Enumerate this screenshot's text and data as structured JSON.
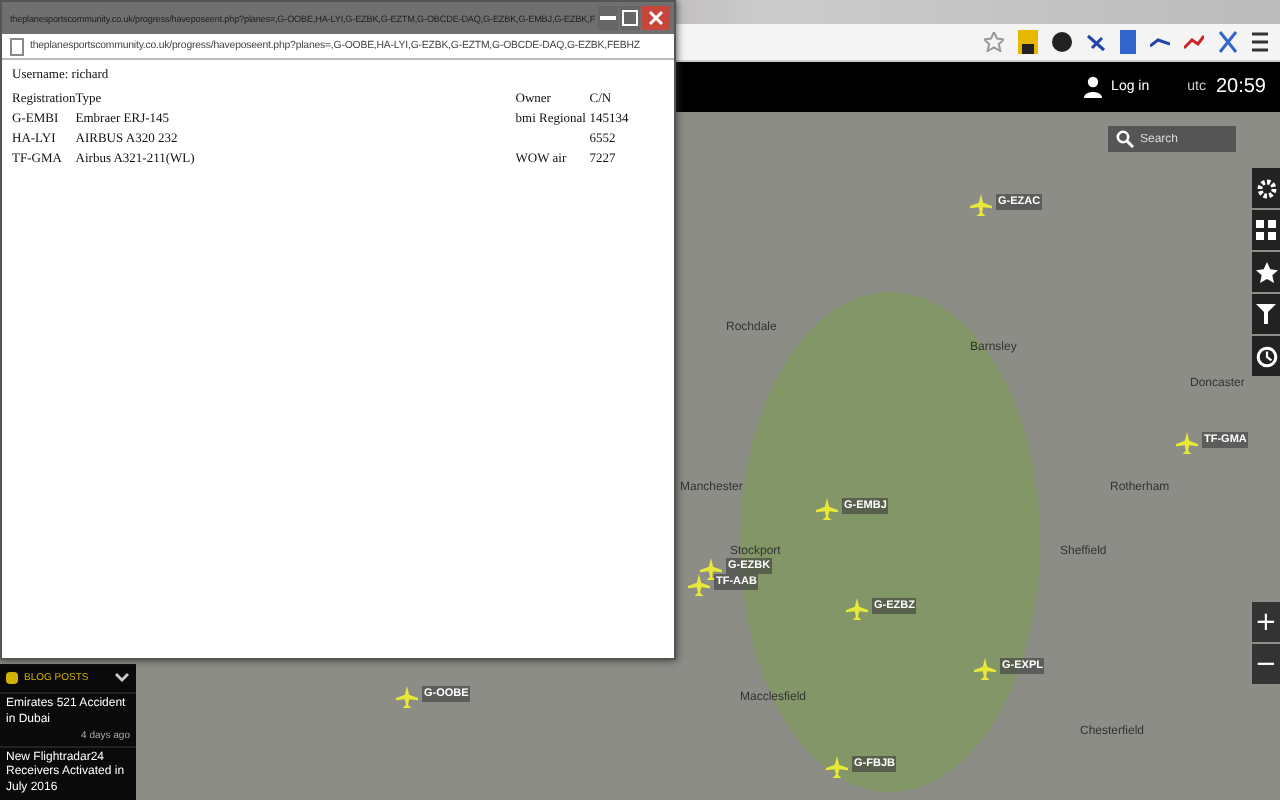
{
  "popup": {
    "title": "theplanesportscommunity.co.uk/progress/haveposeent.php?planes=,G-OOBE,HA-LYI,G-EZBK,G-EZTM,G-OBCDE-DAQ,G-EZBK,G-EMBJ,G-EZBK,F",
    "address": "theplanesportscommunity.co.uk/progress/haveposeent.php?planes=,G-OOBE,HA-LYI,G-EZBK,G-EZTM,G-OBCDE-DAQ,G-EZBK,FEBHZ",
    "username_label": "Username:",
    "username": "richard",
    "columns": [
      "Registration",
      "Type",
      "Owner",
      "C/N"
    ],
    "rows": [
      {
        "registration": "G-EMBI",
        "type": "Embraer ERJ-145",
        "owner": "bmi Regional",
        "cn": "145134"
      },
      {
        "registration": "HA-LYI",
        "type": "AIRBUS A320 232",
        "cn": "6552"
      },
      {
        "registration": "TF-GMA",
        "type": "Airbus A321-211(WL)",
        "owner": "WOW air",
        "cn": "7227"
      }
    ]
  },
  "header": {
    "login": "Log in",
    "utc_label": "utc",
    "time": "20:59"
  },
  "search": {
    "placeholder": "Search"
  },
  "zoom": [
    "+",
    "−"
  ],
  "blog": {
    "title": "BLOG POSTS",
    "posts": [
      {
        "title": "Emirates 521 Accident in Dubai",
        "age": "4 days ago"
      },
      {
        "title": "New Flightradar24 Receivers Activated in July 2016"
      }
    ]
  },
  "map": {
    "places": [
      "Rochdale",
      "Manchester",
      "Stockport",
      "Sheffield",
      "Rotherham",
      "Barnsley",
      "Macclesfield",
      "Chesterfield",
      "Doncaster"
    ],
    "aircraft": [
      "G-EZAC",
      "TF-GMA",
      "G-EMBJ",
      "G-EZBK",
      "TF-AAB",
      "G-EZBZ",
      "G-EXPL",
      "G-FBJB",
      "G-OOBE"
    ]
  }
}
